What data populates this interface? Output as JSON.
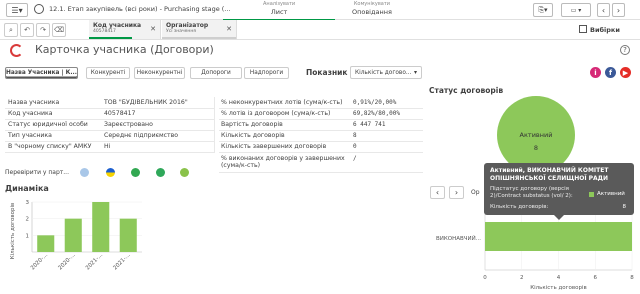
{
  "topnav": {
    "app_title": "12.1. Етап закупівель (всі роки) - Purchasing stage (...",
    "tabs": [
      {
        "sub": "Аналізувати",
        "main": "Лист"
      },
      {
        "sub": "Комунікувати",
        "main": "Оповідання"
      }
    ],
    "selections_label": "Вибірки"
  },
  "selections": [
    {
      "title": "Код учасника",
      "value": "40578417"
    },
    {
      "title": "Організатор",
      "value": "Усі значення"
    }
  ],
  "header": {
    "title": "Карточка учасника (Договори)"
  },
  "filters": {
    "participant_name": "Назва Учасника | К...",
    "buttons": [
      "Конкуренті",
      "Неконкурентні",
      "Допороги",
      "Надпороги"
    ],
    "indicator_label": "Показник",
    "indicator_value": "Кількість догово..."
  },
  "info_left": [
    {
      "label": "Назва учасника",
      "value": "ТОВ \"БУДІВЕЛЬНИК 2016\""
    },
    {
      "label": "Код учасника",
      "value": "40578417"
    },
    {
      "label": "Статус юридичної особи",
      "value": "Зареєстровано"
    },
    {
      "label": "Тип учасника",
      "value": "Середнє підприємство"
    },
    {
      "label": "В \"чорному списку\" АМКУ",
      "value": "Ні"
    }
  ],
  "info_right": [
    {
      "label": "% неконкурентних лотів (сума/к-сть)",
      "value": "0,91%/20,00%"
    },
    {
      "label": "% лотів із договором (сума/к-сть)",
      "value": "69,82%/80,00%"
    },
    {
      "label": "Вартість договорів",
      "value": "6 447 741"
    },
    {
      "label": "Кількість договорів",
      "value": "8"
    },
    {
      "label": "Кількість завершених договорів",
      "value": "0"
    },
    {
      "label": "% виконаних договорів у завершених (сума/к-сть)",
      "value": "/"
    }
  ],
  "check_label": "Перевірити у парт...",
  "dynamics": {
    "title": "Динаміка"
  },
  "status": {
    "title": "Статус договорів",
    "tab_stub": "Ор"
  },
  "tooltip": {
    "title": "Активний, ВИКОНАВЧИЙ КОМІТЕТ ОПІШНЯНСЬКОЇ СЕЛИЩНОЇ РАДИ",
    "substatus_label": "Підстатус договору (версія 2)/Contract substatus (vol/ 2):",
    "substatus_value": "Активний",
    "count_label": "Кількість договорів:",
    "count_value": "8"
  },
  "chart_data": [
    {
      "type": "bar",
      "categories": [
        "2020-...",
        "2020-...",
        "2021-...",
        "2021-..."
      ],
      "values": [
        1,
        2,
        3,
        2
      ],
      "ylabel": "Кількість договорів",
      "ylim": [
        0,
        3
      ],
      "yticks": [
        "1",
        "2",
        "3"
      ],
      "color": "#8dc85a"
    },
    {
      "type": "pie",
      "categories": [
        "Активний"
      ],
      "values": [
        8
      ],
      "data_label": "8",
      "color": "#8dc85a"
    },
    {
      "type": "bar",
      "orientation": "horizontal",
      "categories": [
        "ВИКОНАВЧИЙ..."
      ],
      "values": [
        8
      ],
      "xlabel": "Кількість договорів",
      "xlim": [
        0,
        8
      ],
      "xticks": [
        "0",
        "2",
        "4",
        "6",
        "8"
      ],
      "color": "#8dc85a"
    }
  ],
  "colors": {
    "accent": "#009845",
    "bar": "#8dc85a",
    "facebook": "#3b5998",
    "instagram": "#d62976",
    "youtube": "#e52d27"
  }
}
